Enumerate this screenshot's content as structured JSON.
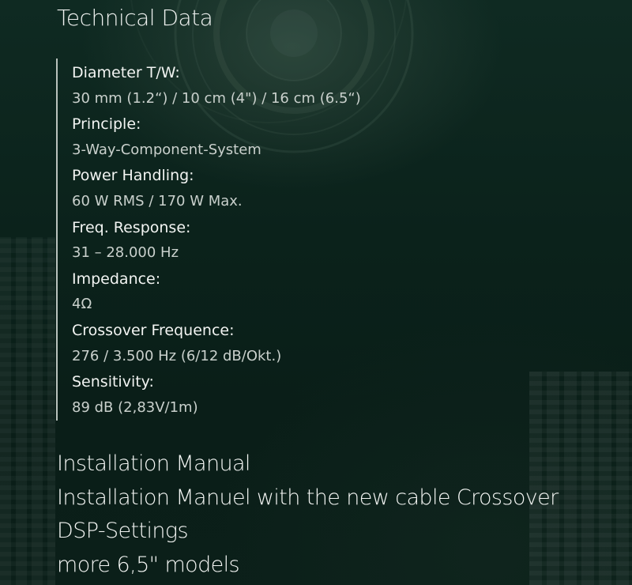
{
  "page": {
    "title": "Technical Data",
    "background_color": "#0b221b",
    "accent_line_color": "#b9c2bd"
  },
  "specs": [
    {
      "label": "Diameter T/W:",
      "value": "30 mm (1.2“) / 10 cm (4\") / 16 cm (6.5“)"
    },
    {
      "label": "Principle:",
      "value": "3-Way-Component-System"
    },
    {
      "label": "Power Handling:",
      "value": "60 W RMS / 170 W Max."
    },
    {
      "label": "Freq. Response:",
      "value": "31 – 28.000 Hz"
    },
    {
      "label": "Impedance:",
      "value": "4Ω"
    },
    {
      "label": "Crossover Frequence:",
      "value": "276 / 3.500 Hz (6/12 dB/Okt.)"
    },
    {
      "label": "Sensitivity:",
      "value": "89 dB (2,83V/1m)"
    }
  ],
  "links": [
    {
      "label": "Installation Manual"
    },
    {
      "label": "Installation Manuel with the new cable Crossover"
    },
    {
      "label": "DSP-Settings"
    },
    {
      "label": "more 6,5\" models"
    }
  ]
}
